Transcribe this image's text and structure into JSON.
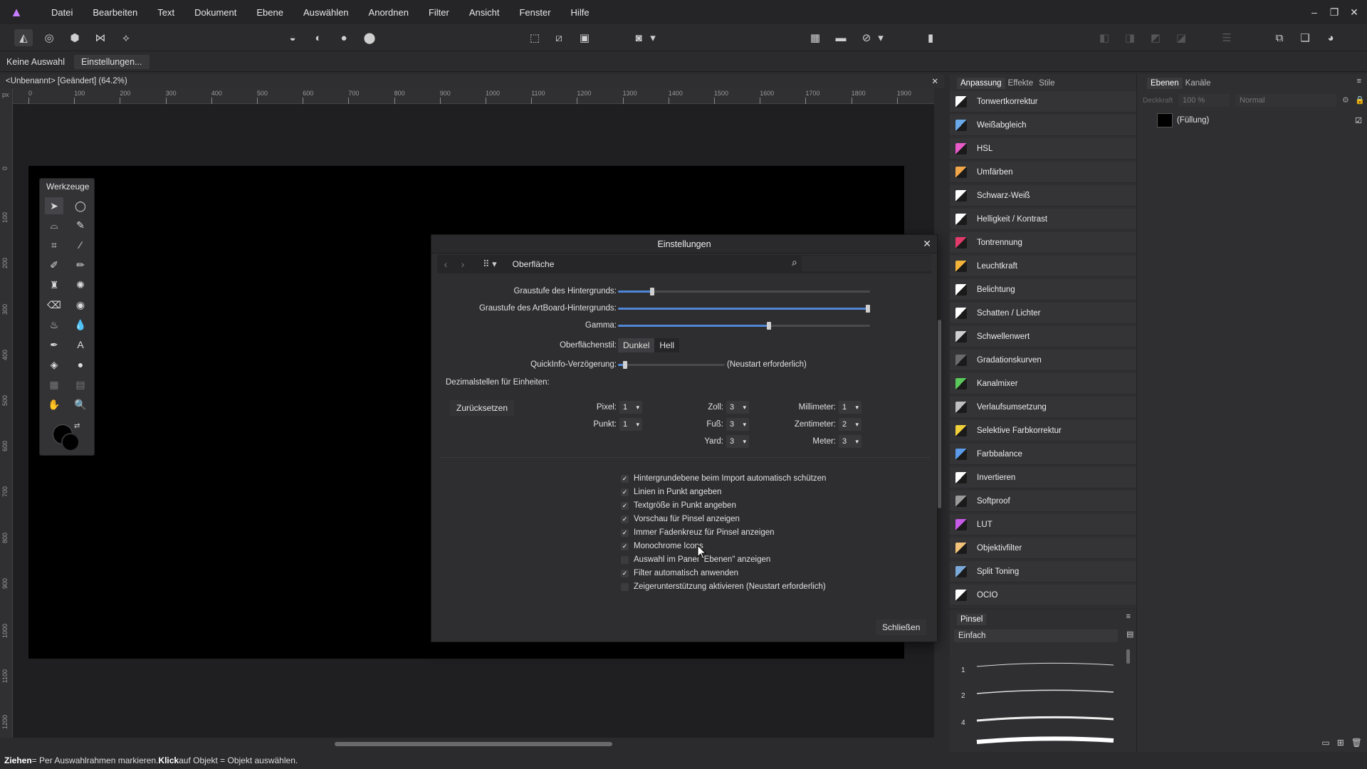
{
  "menubar": {
    "items": [
      "Datei",
      "Bearbeiten",
      "Text",
      "Dokument",
      "Ebene",
      "Auswählen",
      "Anordnen",
      "Filter",
      "Ansicht",
      "Fenster",
      "Hilfe"
    ]
  },
  "context": {
    "selection": "Keine Auswahl",
    "settings_button": "Einstellungen..."
  },
  "document": {
    "tab_title": "<Unbenannt> [Geändert] (64.2%)"
  },
  "ruler": {
    "h_labels": [
      "0",
      "100",
      "200",
      "300",
      "400",
      "500",
      "600",
      "700",
      "800",
      "900",
      "1000",
      "1100",
      "1200",
      "1300",
      "1400",
      "1500",
      "1600",
      "1700",
      "1800",
      "1900"
    ],
    "v_labels": [
      "0",
      "100",
      "200",
      "300",
      "400",
      "500",
      "600",
      "700",
      "800",
      "900",
      "1000",
      "1100",
      "1200"
    ],
    "unit": "px"
  },
  "tools": {
    "title": "Werkzeuge"
  },
  "dialog": {
    "title": "Einstellungen",
    "breadcrumb": "Oberfläche",
    "sliders": [
      {
        "label": "Graustufe des Hintergrunds:",
        "value": 0.13
      },
      {
        "label": "Graustufe des ArtBoard-Hintergrunds:",
        "value": 1.0
      },
      {
        "label": "Gamma:",
        "value": 0.6
      }
    ],
    "style": {
      "label": "Oberflächenstil:",
      "options": [
        "Dunkel",
        "Hell"
      ],
      "selected": "Dunkel"
    },
    "tooltip": {
      "label": "QuickInfo-Verzögerung:",
      "note": "(Neustart erforderlich)",
      "value": 0.05
    },
    "decimals_title": "Dezimalstellen für Einheiten:",
    "reset_button": "Zurücksetzen",
    "units": [
      {
        "label": "Pixel:",
        "value": "1"
      },
      {
        "label": "Punkt:",
        "value": "1"
      },
      {
        "label": "Zoll:",
        "value": "3"
      },
      {
        "label": "Fuß:",
        "value": "3"
      },
      {
        "label": "Yard:",
        "value": "3"
      },
      {
        "label": "Millimeter:",
        "value": "1"
      },
      {
        "label": "Zentimeter:",
        "value": "2"
      },
      {
        "label": "Meter:",
        "value": "3"
      }
    ],
    "checkboxes": [
      {
        "label": "Hintergrundebene beim Import automatisch schützen",
        "checked": true
      },
      {
        "label": "Linien in Punkt angeben",
        "checked": true
      },
      {
        "label": "Textgröße in Punkt angeben",
        "checked": true
      },
      {
        "label": "Vorschau für Pinsel anzeigen",
        "checked": true
      },
      {
        "label": "Immer Fadenkreuz für Pinsel anzeigen",
        "checked": true
      },
      {
        "label": "Monochrome Icons",
        "checked": true
      },
      {
        "label": "Auswahl im Panel \"Ebenen\" anzeigen",
        "checked": false
      },
      {
        "label": "Filter automatisch anwenden",
        "checked": true
      },
      {
        "label": "Zeigerunterstützung aktivieren (Neustart erforderlich)",
        "checked": false
      }
    ],
    "close_button": "Schließen"
  },
  "adjust_panel": {
    "tabs": [
      "Anpassung",
      "Effekte",
      "Stile"
    ],
    "items": [
      {
        "label": "Tonwertkorrektur",
        "color": "#ffffff"
      },
      {
        "label": "Weißabgleich",
        "color": "#6aa8e8"
      },
      {
        "label": "HSL",
        "color": "#e85ac8"
      },
      {
        "label": "Umfärben",
        "color": "#f2a64a"
      },
      {
        "label": "Schwarz-Weiß",
        "color": "#ffffff"
      },
      {
        "label": "Helligkeit / Kontrast",
        "color": "#ffffff"
      },
      {
        "label": "Tontrennung",
        "color": "#e23a6b"
      },
      {
        "label": "Leuchtkraft",
        "color": "#f2b33a"
      },
      {
        "label": "Belichtung",
        "color": "#ffffff"
      },
      {
        "label": "Schatten / Lichter",
        "color": "#ffffff"
      },
      {
        "label": "Schwellenwert",
        "color": "#cfcfcf"
      },
      {
        "label": "Gradationskurven",
        "color": "#6a6a6a"
      },
      {
        "label": "Kanalmixer",
        "color": "#5ac85a"
      },
      {
        "label": "Verlaufsumsetzung",
        "color": "#bfbfbf"
      },
      {
        "label": "Selektive Farbkorrektur",
        "color": "#f2d03a"
      },
      {
        "label": "Farbbalance",
        "color": "#5a9ae8"
      },
      {
        "label": "Invertieren",
        "color": "#ffffff"
      },
      {
        "label": "Softproof",
        "color": "#9a9a9a"
      },
      {
        "label": "LUT",
        "color": "#c85ae8"
      },
      {
        "label": "Objektivfilter",
        "color": "#f2c27a"
      },
      {
        "label": "Split Toning",
        "color": "#7aa8d8"
      },
      {
        "label": "OCIO",
        "color": "#ffffff"
      }
    ]
  },
  "brush_panel": {
    "title": "Pinsel",
    "category": "Einfach",
    "sizes": [
      "1",
      "2",
      "4"
    ]
  },
  "layers_panel": {
    "tabs": [
      "Ebenen",
      "Kanäle"
    ],
    "opacity": "100 %",
    "blend": "Normal",
    "opacity_label": "Deckkraft",
    "layer_name": "(Füllung)"
  },
  "status": {
    "b1": "Ziehen",
    "t1": " = Per Auswahlrahmen markieren. ",
    "b2": "Klick",
    "t2": " auf Objekt = Objekt auswählen."
  }
}
